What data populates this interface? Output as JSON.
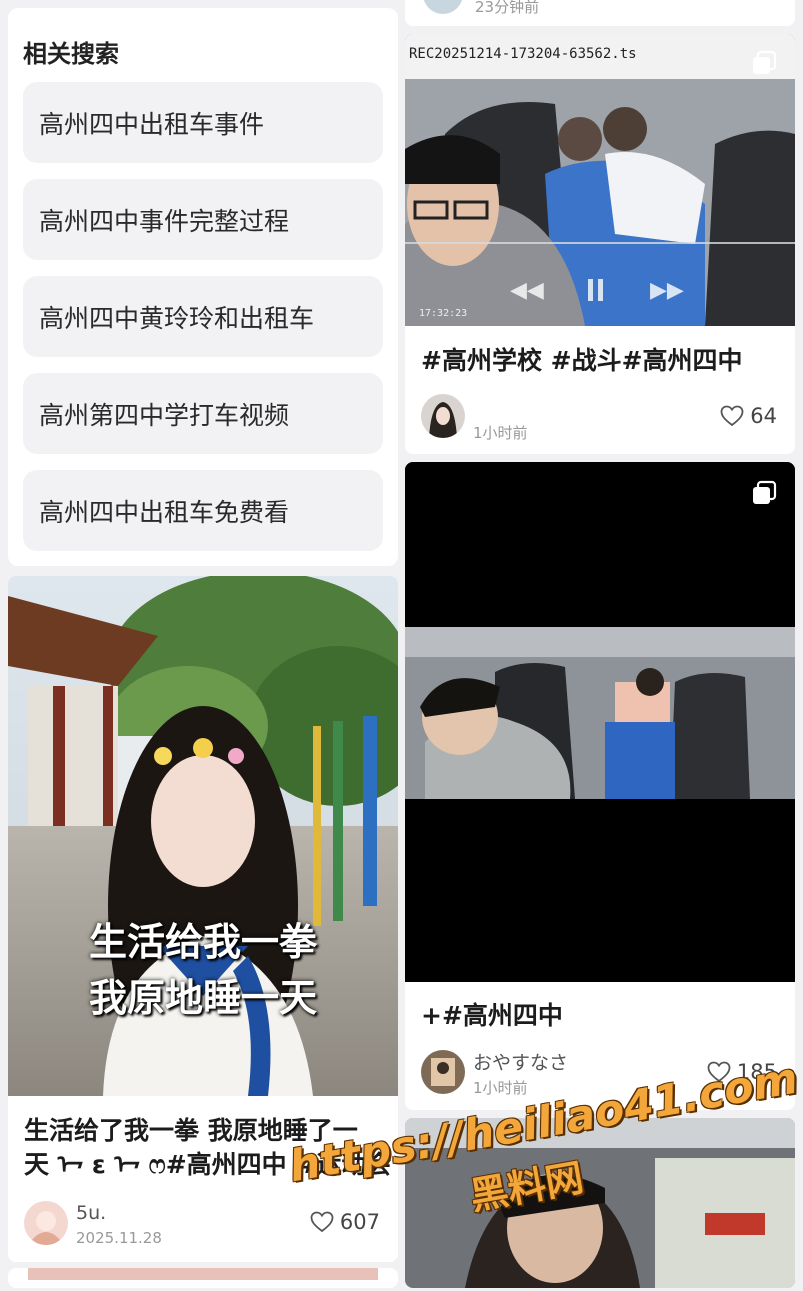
{
  "related": {
    "title": "相关搜索",
    "items": [
      "高州四中出租车事件",
      "高州四中事件完整过程",
      "高州四中黄玲玲和出租车",
      "高州第四中学打车视频",
      "高州四中出租车免费看"
    ]
  },
  "top_partial": {
    "time": "23分钟前"
  },
  "left_card": {
    "overlay_line1": "生活给我一拳",
    "overlay_line2": "我原地睡一天",
    "title_line1": "生活给了我一拳 我原地睡了一",
    "title_line2": "天 ᢇ ε ᢇ ෆ#高州四中 #运动会",
    "author": "5u.",
    "date": "2025.11.28",
    "likes": "607"
  },
  "card1": {
    "filename": "REC20251214-173204-63562.ts",
    "timestamp": "17:32:23",
    "title": "#高州学校 #战斗#高州四中",
    "time": "1小时前",
    "likes": "64"
  },
  "card2": {
    "title": "+#高州四中",
    "author": "おやすなさ",
    "time": "1小时前",
    "likes": "185"
  },
  "watermark": {
    "url": "https://heiliao41.com",
    "name": "黑料网"
  },
  "icons": {
    "heart": "heart-outline-icon",
    "multi": "multi-image-icon"
  },
  "colors": {
    "background": "#f1f1f3",
    "chip": "#f2f2f4",
    "watermark": "#f3a73a"
  }
}
